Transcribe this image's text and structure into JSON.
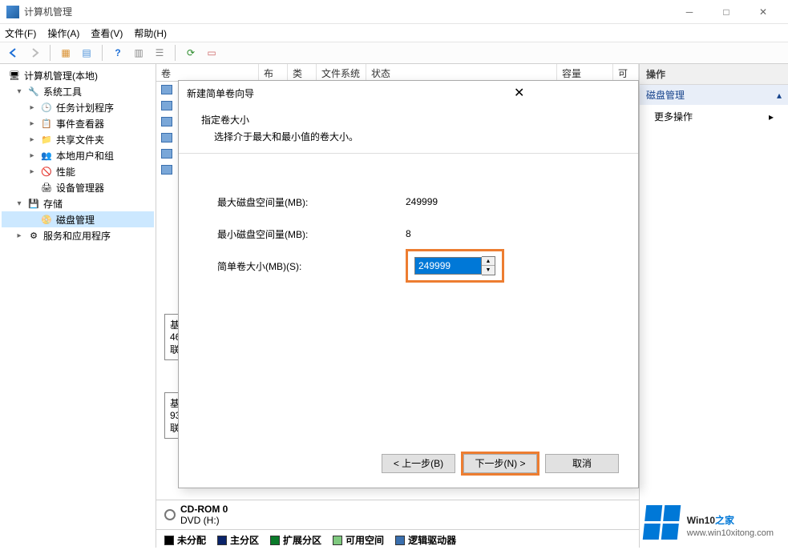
{
  "title": "计算机管理",
  "menu": {
    "file": "文件(F)",
    "action": "操作(A)",
    "view": "查看(V)",
    "help": "帮助(H)"
  },
  "tree": {
    "root": "计算机管理(本地)",
    "system_tools": "系统工具",
    "task_scheduler": "任务计划程序",
    "event_viewer": "事件查看器",
    "shared_folders": "共享文件夹",
    "local_users": "本地用户和组",
    "performance": "性能",
    "device_manager": "设备管理器",
    "storage": "存储",
    "disk_management": "磁盘管理",
    "services": "服务和应用程序"
  },
  "columns": {
    "volume": "卷",
    "layout": "布局",
    "type": "类型",
    "filesystem": "文件系统",
    "status": "状态",
    "capacity": "容量",
    "free": "可"
  },
  "disk_partial": {
    "b1": "基",
    "b2": "46",
    "b3": "联",
    "c1": "基",
    "c2": "93",
    "c3": "联"
  },
  "actions": {
    "header": "操作",
    "disk_mgmt": "磁盘管理",
    "more": "更多操作"
  },
  "dialog": {
    "title": "新建简单卷向导",
    "heading": "指定卷大小",
    "sub": "选择介于最大和最小值的卷大小。",
    "max_label": "最大磁盘空间量(MB):",
    "max_value": "249999",
    "min_label": "最小磁盘空间量(MB):",
    "min_value": "8",
    "size_label": "简单卷大小(MB)(S):",
    "size_value": "249999",
    "back": "< 上一步(B)",
    "next": "下一步(N) >",
    "cancel": "取消"
  },
  "cdrom": {
    "name": "CD-ROM 0",
    "drive": "DVD (H:)"
  },
  "legend": {
    "unallocated": "未分配",
    "primary": "主分区",
    "extended": "扩展分区",
    "free": "可用空间",
    "logical": "逻辑驱动器"
  },
  "watermark": {
    "brand_a": "Win10",
    "brand_b": "之家",
    "url": "www.win10xitong.com"
  }
}
